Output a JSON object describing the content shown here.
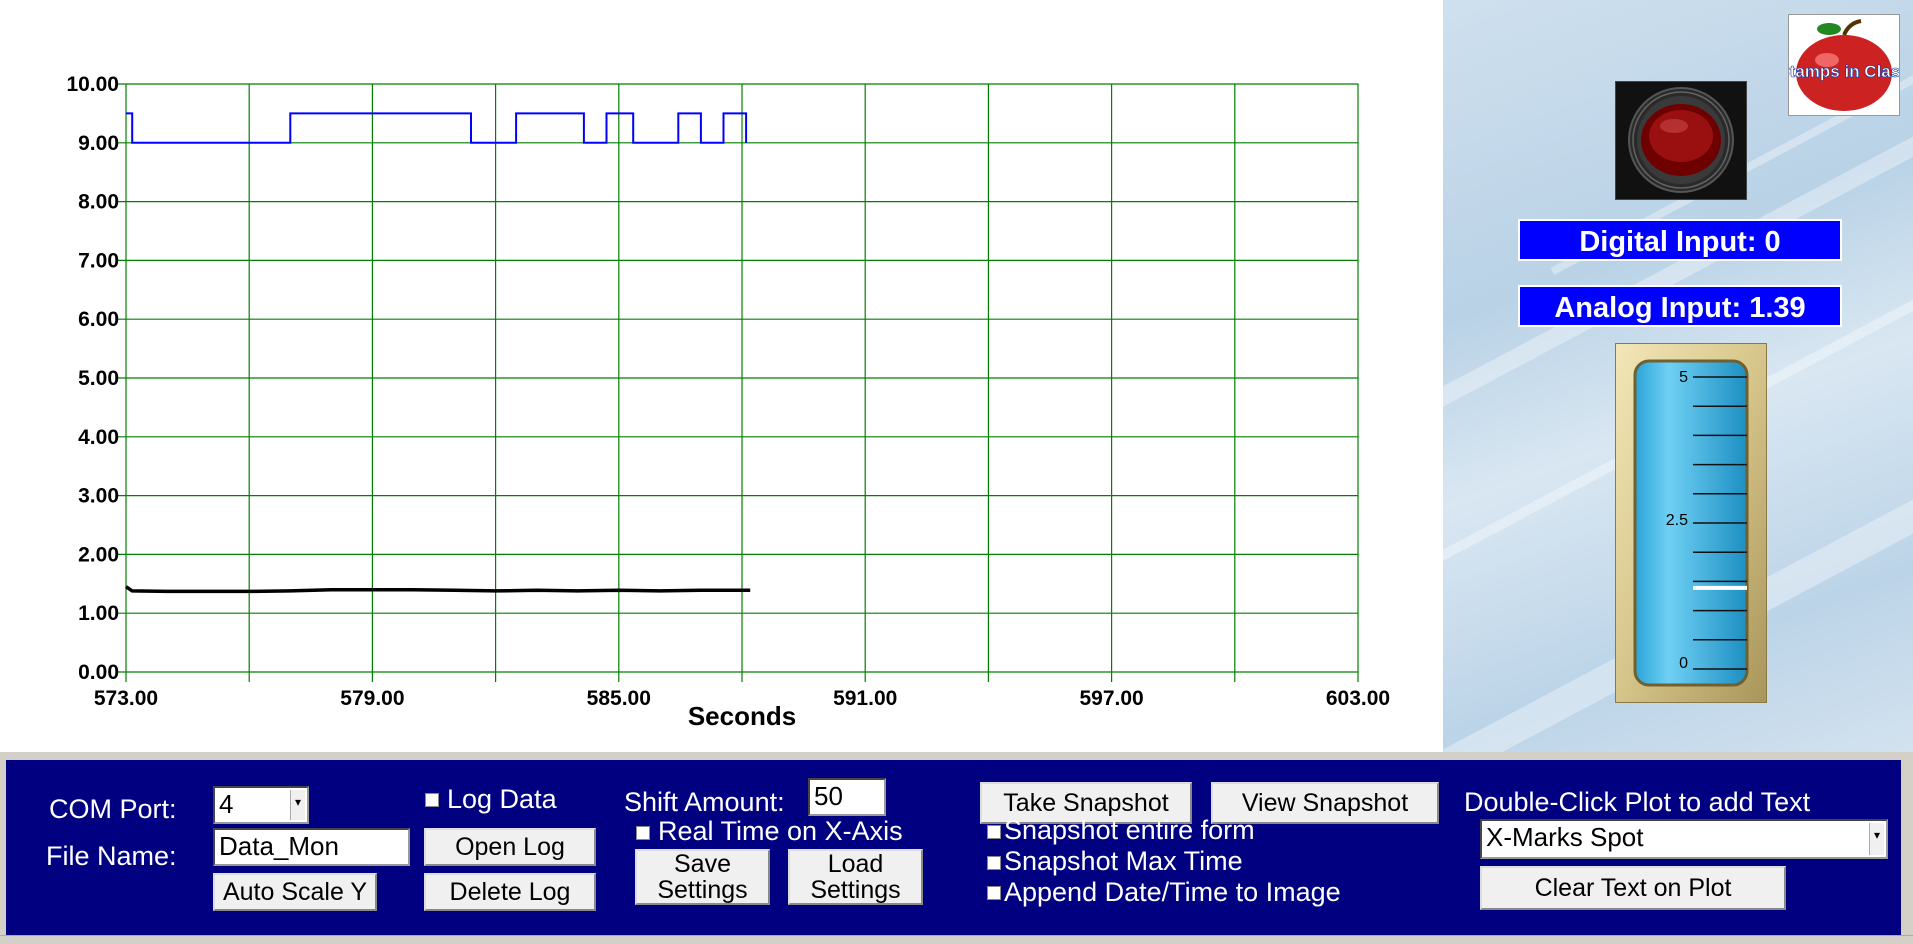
{
  "chart_data": {
    "type": "line",
    "xlabel": "Seconds",
    "ylabel": "",
    "xlim": [
      573,
      603
    ],
    "ylim": [
      0,
      10
    ],
    "x_ticks": [
      "573.00",
      "579.00",
      "585.00",
      "591.00",
      "597.00",
      "603.00"
    ],
    "y_ticks": [
      "0.00",
      "1.00",
      "2.00",
      "3.00",
      "4.00",
      "5.00",
      "6.00",
      "7.00",
      "8.00",
      "9.00",
      "10.00"
    ],
    "grid": true,
    "series": [
      {
        "color": "#0000ff",
        "points": [
          [
            573.0,
            9.5
          ],
          [
            573.15,
            9.5
          ],
          [
            573.15,
            9.0
          ],
          [
            577.0,
            9.0
          ],
          [
            577.0,
            9.5
          ],
          [
            581.4,
            9.5
          ],
          [
            581.4,
            9.0
          ],
          [
            582.5,
            9.0
          ],
          [
            582.5,
            9.5
          ],
          [
            584.15,
            9.5
          ],
          [
            584.15,
            9.0
          ],
          [
            584.7,
            9.0
          ],
          [
            584.7,
            9.5
          ],
          [
            585.35,
            9.5
          ],
          [
            585.35,
            9.0
          ],
          [
            586.45,
            9.0
          ],
          [
            586.45,
            9.5
          ],
          [
            587.0,
            9.5
          ],
          [
            587.0,
            9.0
          ],
          [
            587.55,
            9.0
          ],
          [
            587.55,
            9.5
          ],
          [
            588.1,
            9.5
          ],
          [
            588.1,
            9.0
          ]
        ]
      },
      {
        "color": "#000000",
        "points": [
          [
            573.0,
            1.45
          ],
          [
            573.15,
            1.38
          ],
          [
            574.0,
            1.37
          ],
          [
            576.0,
            1.37
          ],
          [
            577.0,
            1.38
          ],
          [
            578.0,
            1.4
          ],
          [
            580.0,
            1.4
          ],
          [
            581.0,
            1.39
          ],
          [
            582.0,
            1.38
          ],
          [
            583.0,
            1.39
          ],
          [
            584.0,
            1.38
          ],
          [
            585.0,
            1.39
          ],
          [
            586.0,
            1.38
          ],
          [
            587.0,
            1.39
          ],
          [
            588.2,
            1.39
          ]
        ]
      }
    ]
  },
  "indicators": {
    "digital_input": "Digital Input: 0",
    "analog_input": "Analog Input: 1.39",
    "gauge": {
      "max_label": "5",
      "mid_label": "2.5",
      "min_label": "0",
      "min": 0,
      "max": 5,
      "value": 1.39
    },
    "logo_text": "Stamps in Class",
    "button_icon": "red-push-button-icon"
  },
  "controls": {
    "com_port_label": "COM Port:",
    "com_port_value": "4",
    "file_name_label": "File Name:",
    "file_name_value": "Data_Mon",
    "auto_scale_label": "Auto Scale Y",
    "log_data_label": "Log Data",
    "open_log_label": "Open Log",
    "delete_log_label": "Delete Log",
    "shift_amount_label": "Shift Amount:",
    "shift_amount_value": "50",
    "real_time_label": "Real Time on X-Axis",
    "save_settings_line1": "Save",
    "save_settings_line2": "Settings",
    "load_settings_line1": "Load",
    "load_settings_line2": "Settings",
    "take_snapshot_label": "Take Snapshot",
    "view_snapshot_label": "View Snapshot",
    "snapshot_entire_label": "Snapshot entire form",
    "snapshot_max_label": "Snapshot Max Time",
    "append_date_label": "Append Date/Time to Image",
    "double_click_label": "Double-Click Plot to add Text",
    "text_select_value": "X-Marks Spot",
    "clear_text_label": "Clear Text on Plot"
  },
  "colors": {
    "panel_bg": "#000080",
    "info_box_bg": "#0000ff",
    "grid": "#008000",
    "series_1": "#0000ff",
    "series_2": "#000000"
  }
}
